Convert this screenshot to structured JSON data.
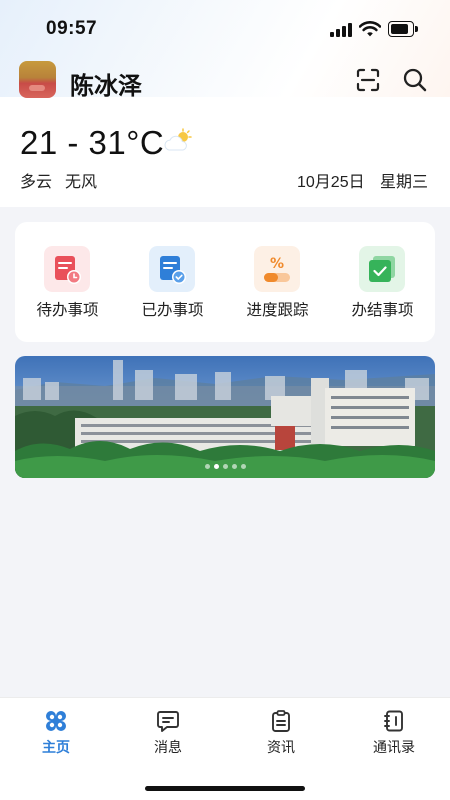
{
  "status_bar": {
    "time": "09:57"
  },
  "header": {
    "user_name": "陈冰泽",
    "scan_icon": "scan-icon",
    "search_icon": "search-icon"
  },
  "weather": {
    "temperature": "21 - 31°C",
    "icon": "partly-cloudy-icon",
    "condition": "多云",
    "wind": "无风",
    "date": "10月25日",
    "weekday": "星期三"
  },
  "quick_actions": [
    {
      "label": "待办事项",
      "icon": "todo-clock-icon",
      "bg": "#fde8e9",
      "color": "#e9505a"
    },
    {
      "label": "已办事项",
      "icon": "done-check-icon",
      "bg": "#e3effb",
      "color": "#2f7fd8"
    },
    {
      "label": "进度跟踪",
      "icon": "progress-percent-icon",
      "bg": "#fdf0e5",
      "color": "#f08a2c"
    },
    {
      "label": "办结事项",
      "icon": "completed-box-icon",
      "bg": "#e3f5e7",
      "color": "#36b35a"
    }
  ],
  "banner": {
    "slide_count": 5,
    "active_index": 1
  },
  "tabbar": {
    "active_color": "#2f7fd8",
    "items": [
      {
        "label": "主页",
        "icon": "home-grid-icon",
        "active": true
      },
      {
        "label": "消息",
        "icon": "message-icon",
        "active": false
      },
      {
        "label": "资讯",
        "icon": "news-clipboard-icon",
        "active": false
      },
      {
        "label": "通讯录",
        "icon": "contacts-book-icon",
        "active": false
      }
    ]
  }
}
